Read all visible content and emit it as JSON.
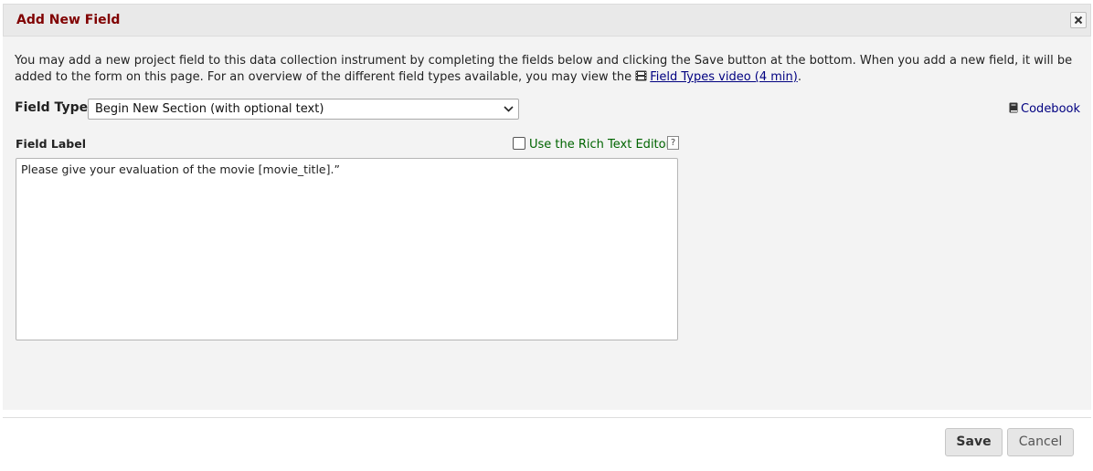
{
  "dialog": {
    "title": "Add New Field",
    "close_icon": "close-icon"
  },
  "intro": {
    "text_before_link": "You may add a new project field to this data collection instrument by completing the fields below and clicking the Save button at the bottom. When you add a new field, it will be added to the form on this page. For an overview of the different field types available, you may view the ",
    "link_icon": "film-icon",
    "link_text": "Field Types video (4 min)",
    "text_after_link": "."
  },
  "field_type": {
    "label": "Field Type:",
    "selected": "Begin New Section (with optional text)"
  },
  "codebook": {
    "icon": "book-icon",
    "label": "Codebook"
  },
  "field_label": {
    "label": "Field Label",
    "value": "Please give your evaluation of the movie [movie_title].”"
  },
  "rich_text": {
    "label": "Use the Rich Text Editor",
    "checked": false,
    "help": "?"
  },
  "footer": {
    "save_label": "Save",
    "cancel_label": "Cancel"
  },
  "colors": {
    "title": "#800000",
    "link": "#000080",
    "rich_text_label": "#006400",
    "content_bg": "#f3f3f3",
    "titlebar_bg": "#e9e9e9"
  }
}
